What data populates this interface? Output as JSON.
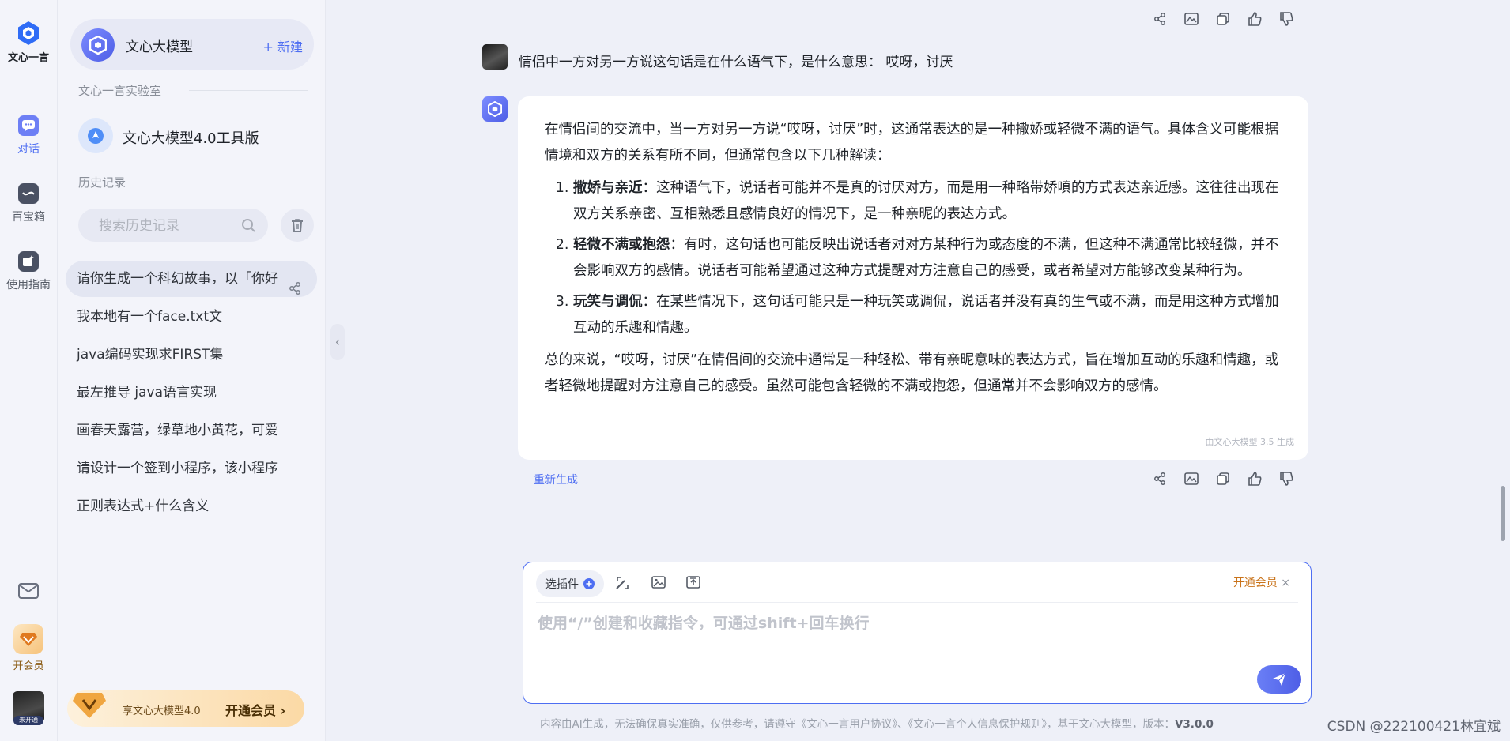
{
  "rail": {
    "logo_text": "文心一言",
    "items": [
      {
        "label": "对话",
        "icon": "chat-icon"
      },
      {
        "label": "百宝箱",
        "icon": "toolbox-icon"
      },
      {
        "label": "使用指南",
        "icon": "guide-icon"
      }
    ],
    "vip_label": "开会员",
    "avatar_tag": "未开通"
  },
  "sidebar": {
    "model_name": "文心大模型",
    "new_label": "+ 新建",
    "lab_title": "文心一言实验室",
    "tool_name": "文心大模型4.0工具版",
    "history_title": "历史记录",
    "search_placeholder": "搜索历史记录",
    "history": [
      "请你生成一个科幻故事，以「你好",
      "我本地有一个face.txt文",
      "java编码实现求FIRST集",
      "最左推导 java语言实现",
      "画春天露营，绿草地小黄花，可爱",
      "请设计一个签到小程序，该小程序",
      "正则表达式+什么含义"
    ],
    "promo_text": "享文心大模型4.0",
    "promo_button": "开通会员 ›"
  },
  "chat": {
    "user_message": "情侣中一方对另一方说这句话是在什么语气下，是什么意思： 哎呀，讨厌",
    "answer_intro": "在情侣间的交流中，当一方对另一方说“哎呀，讨厌”时，这通常表达的是一种撒娇或轻微不满的语气。具体含义可能根据情境和双方的关系有所不同，但通常包含以下几种解读：",
    "points": [
      {
        "title": "撒娇与亲近",
        "text": "：这种语气下，说话者可能并不是真的讨厌对方，而是用一种略带娇嗔的方式表达亲近感。这往往出现在双方关系亲密、互相熟悉且感情良好的情况下，是一种亲昵的表达方式。"
      },
      {
        "title": "轻微不满或抱怨",
        "text": "：有时，这句话也可能反映出说话者对对方某种行为或态度的不满，但这种不满通常比较轻微，并不会影响双方的感情。说话者可能希望通过这种方式提醒对方注意自己的感受，或者希望对方能够改变某种行为。"
      },
      {
        "title": "玩笑与调侃",
        "text": "：在某些情况下，这句话可能只是一种玩笑或调侃，说话者并没有真的生气或不满，而是用这种方式增加互动的乐趣和情趣。"
      }
    ],
    "answer_summary": "总的来说，“哎呀，讨厌”在情侣间的交流中通常是一种轻松、带有亲昵意味的表达方式，旨在增加互动的乐趣和情趣，或者轻微地提醒对方注意自己的感受。虽然可能包含轻微的不满或抱怨，但通常并不会影响双方的感情。",
    "generated_by": "由文心大模型 3.5 生成",
    "regenerate_label": "重新生成",
    "action_icons": [
      "share-icon",
      "image-icon",
      "copy-icon",
      "thumbs-up-icon",
      "thumbs-down-icon"
    ]
  },
  "composer": {
    "plugin_label": "选插件",
    "vip_label": "开通会员",
    "placeholder": "使用“/”创建和收藏指令，可通过shift+回车换行"
  },
  "footer": {
    "note": "内容由AI生成，无法确保真实准确，仅供参考，请遵守《文心一言用户协议》、《文心一言个人信息保护规则》，基于文心大模型，版本：",
    "version": "V3.0.0",
    "watermark": "CSDN @222100421林宜斌"
  },
  "colors": {
    "accent": "#4e6ef2",
    "vip": "#c9731a",
    "background": "#eef0f8"
  }
}
